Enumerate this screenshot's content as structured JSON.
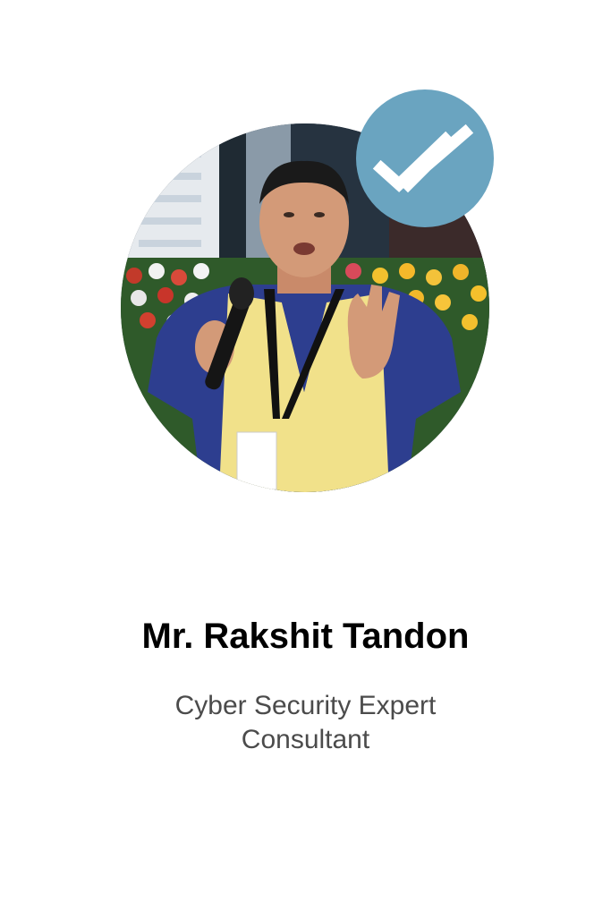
{
  "profile": {
    "name": "Mr. Rakshit Tandon",
    "titles": [
      "Cyber Security Expert",
      "Consultant"
    ],
    "photo_icon": "person-photo",
    "badge_icon": "double-check-icon"
  },
  "colors": {
    "badge": "#6aa4c0",
    "name_text": "#000000",
    "title_text": "#4b4b4b",
    "background": "#ffffff"
  }
}
